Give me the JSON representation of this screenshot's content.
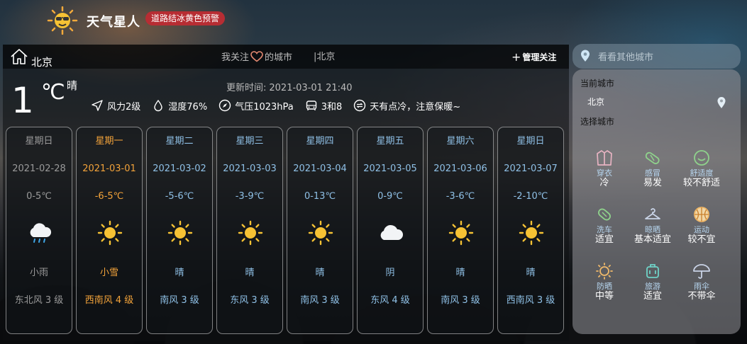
{
  "app": {
    "title": "天气星人",
    "alert": "道路结冰黄色预警"
  },
  "topbar": {
    "city": "北京",
    "follow_prefix": "我关注",
    "follow_suffix": "的城市",
    "follow_sep_city": "|北京",
    "manage_label": "管理关注"
  },
  "current": {
    "temp": "1",
    "unit": "℃",
    "condition": "晴",
    "updated_label": "更新时间:",
    "updated_time": "2021-03-01 21:40",
    "metrics": [
      {
        "icon": "wind-arrow-icon",
        "text": "风力2级"
      },
      {
        "icon": "drop-icon",
        "text": "湿度76%"
      },
      {
        "icon": "compass-icon",
        "text": "气压1023hPa"
      },
      {
        "icon": "car-icon",
        "text": "3和8"
      },
      {
        "icon": "comfort-icon",
        "text": "天有点冷，注意保暖~"
      }
    ]
  },
  "forecast": [
    {
      "weekday": "星期日",
      "date": "2021-02-28",
      "range": "0-5℃",
      "icon": "rain-icon",
      "weather": "小雨",
      "wind": "东北风 3 级",
      "state": "past"
    },
    {
      "weekday": "星期一",
      "date": "2021-03-01",
      "range": "-6-5℃",
      "icon": "sun-icon",
      "weather": "小雪",
      "wind": "西南风 4 级",
      "state": "today"
    },
    {
      "weekday": "星期二",
      "date": "2021-03-02",
      "range": "-5-6℃",
      "icon": "sun-icon",
      "weather": "晴",
      "wind": "南风 3 级",
      "state": "future"
    },
    {
      "weekday": "星期三",
      "date": "2021-03-03",
      "range": "-3-9℃",
      "icon": "sun-icon",
      "weather": "晴",
      "wind": "东风 3 级",
      "state": "future"
    },
    {
      "weekday": "星期四",
      "date": "2021-03-04",
      "range": "0-13℃",
      "icon": "sun-icon",
      "weather": "晴",
      "wind": "南风 3 级",
      "state": "future"
    },
    {
      "weekday": "星期五",
      "date": "2021-03-05",
      "range": "0-9℃",
      "icon": "cloud-icon",
      "weather": "阴",
      "wind": "东风 4 级",
      "state": "future"
    },
    {
      "weekday": "星期六",
      "date": "2021-03-06",
      "range": "-3-6℃",
      "icon": "sun-icon",
      "weather": "晴",
      "wind": "南风 3 级",
      "state": "future"
    },
    {
      "weekday": "星期日",
      "date": "2021-03-07",
      "range": "-2-10℃",
      "icon": "sun-icon",
      "weather": "晴",
      "wind": "西南风 3 级",
      "state": "future"
    }
  ],
  "search": {
    "placeholder": "看看其他城市"
  },
  "side": {
    "current_label": "当前城市",
    "current_city": "北京",
    "choose_label": "选择城市",
    "life": [
      {
        "icon": "coat-icon",
        "name": "穿衣",
        "value": "冷",
        "color": "#e7b3c2"
      },
      {
        "icon": "pill-icon",
        "name": "感冒",
        "value": "易发",
        "color": "#8fd28c"
      },
      {
        "icon": "smile-icon",
        "name": "舒适度",
        "value": "较不舒适",
        "color": "#8fd28c"
      },
      {
        "icon": "capsule-icon",
        "name": "洗车",
        "value": "适宜",
        "color": "#8fd28c"
      },
      {
        "icon": "hanger-icon",
        "name": "晾晒",
        "value": "基本适宜",
        "color": "#c9d3e6"
      },
      {
        "icon": "ball-icon",
        "name": "运动",
        "value": "较不宜",
        "color": "#f0b96a"
      },
      {
        "icon": "sunscreen-icon",
        "name": "防晒",
        "value": "中等",
        "color": "#f0b96a"
      },
      {
        "icon": "luggage-icon",
        "name": "旅游",
        "value": "适宜",
        "color": "#6fd1c6"
      },
      {
        "icon": "umbrella-icon",
        "name": "雨伞",
        "value": "不带伞",
        "color": "#c9d3e6"
      }
    ]
  }
}
